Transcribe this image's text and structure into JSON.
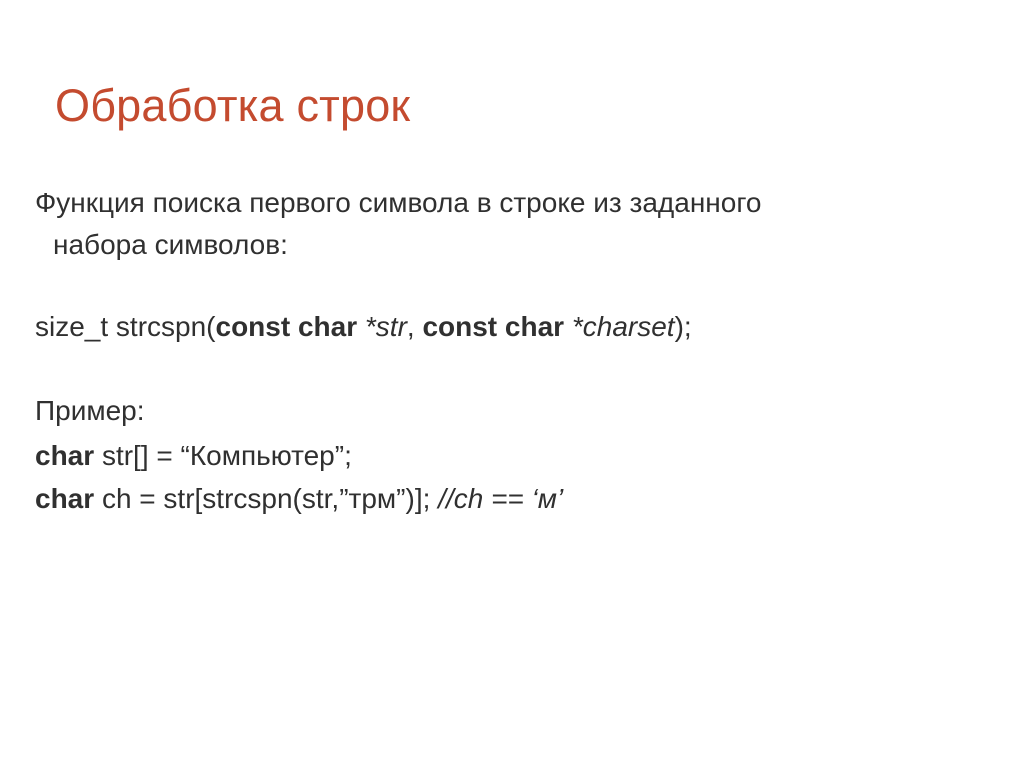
{
  "title": "Обработка строк",
  "intro_line1": "Функция поиска первого символа в строке из заданного",
  "intro_line2": "набора символов:",
  "sig": {
    "p1": "size_t strcspn(",
    "kw1": "const char ",
    "arg1": "*str",
    "sep": ", ",
    "kw2": "const char ",
    "arg2": "*charset",
    "p2": ");"
  },
  "example_label": "Пример:",
  "line1": {
    "kw": "char ",
    "rest": "str[] = “Компьютер”;"
  },
  "line2": {
    "kw": "char ",
    "mid": "ch = str[strcspn(str,”трм”)]; ",
    "comment": "//ch == ‘м’"
  }
}
